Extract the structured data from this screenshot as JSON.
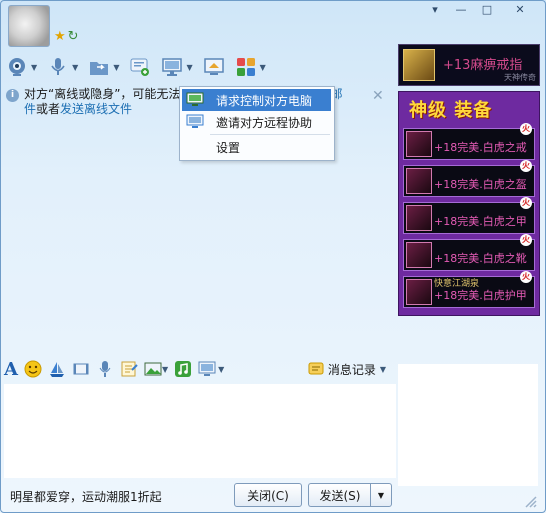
{
  "title_controls": {
    "menu": "▾",
    "minimize": "—",
    "maximize": "□",
    "close": "✕"
  },
  "status_icons": [
    "★",
    "↻"
  ],
  "toolbar": {
    "items": [
      {
        "name": "camera",
        "icon": "webcam-icon"
      },
      {
        "name": "voice",
        "icon": "microphone-icon"
      },
      {
        "name": "file",
        "icon": "folder-icon"
      },
      {
        "name": "sms",
        "icon": "message-icon"
      },
      {
        "name": "remote",
        "icon": "remote-desktop-icon"
      },
      {
        "name": "share",
        "icon": "screen-share-icon"
      },
      {
        "name": "apps",
        "icon": "apps-icon"
      }
    ]
  },
  "notice": {
    "line1": "对方“离线或隐身”，可能无法",
    "line1_tail": "送邮",
    "line2_a": "件",
    "line2_b": "或者",
    "line2_link": "发送离线文件",
    "close": "✕"
  },
  "context_menu": {
    "items": [
      {
        "label": "请求控制对方电脑",
        "highlighted": true
      },
      {
        "label": "邀请对方远程协助",
        "highlighted": false
      },
      {
        "label": "设置",
        "highlighted": false
      }
    ]
  },
  "ads": {
    "top": {
      "title": "+13麻痹戒指",
      "sub": "天神传奇"
    },
    "main": {
      "banner": "神级 装备",
      "rows": [
        {
          "text": "+18完美.白虎之戒",
          "top": ""
        },
        {
          "text": "+18完美.白虎之盔",
          "top": ""
        },
        {
          "text": "+18完美.白虎之甲",
          "top": ""
        },
        {
          "text": "+18完美.白虎之靴",
          "top": ""
        },
        {
          "text": "+18完美.白虎护甲",
          "top": "快意江湖泉"
        }
      ],
      "badge": "火"
    }
  },
  "format_bar": {
    "font_label": "A",
    "msg_record": "消息记录"
  },
  "bottom": {
    "status_text": "明星都爱穿，运动潮服1折起",
    "close_label": "关闭(C)",
    "send_label": "发送(S)",
    "send_arrow": "▼"
  },
  "colors": {
    "accent": "#3a7fd0",
    "link": "#1d6fb3",
    "ad_bg": "#6e2aa0"
  }
}
